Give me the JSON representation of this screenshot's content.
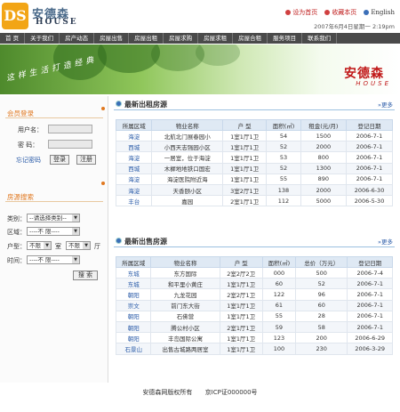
{
  "header": {
    "logo_ds": "DS",
    "logo_cn": "安德森",
    "logo_en": "HOUSE",
    "top_links": [
      {
        "label": "设为首页"
      },
      {
        "label": "收藏本页"
      },
      {
        "label": "English"
      }
    ],
    "date": "2007年6月4日星期一  2:19pm"
  },
  "nav": [
    "首  页",
    "关于我们",
    "房产动态",
    "房屋出售",
    "房屋出租",
    "房屋求购",
    "房屋求租",
    "房屋合租",
    "服务项目",
    "联系我们"
  ],
  "banner": {
    "slogan": "这样生活打造经典",
    "brand_cn": "安德森",
    "brand_en": "HOUSE"
  },
  "login": {
    "title": "会员登录",
    "user_label": "用户名：",
    "user_value": "",
    "pass_label": "密  码：",
    "pass_value": "",
    "forgot": "忘记密码",
    "login_btn": "登录",
    "register_btn": "注册"
  },
  "search": {
    "title": "房源搜索",
    "type_label": "类别：",
    "type_value": "--请选择类别--",
    "region_label": "区域：",
    "region_value": "----不  限----",
    "layout_label": "户型：",
    "room_value": "不限",
    "room_unit": "室",
    "hall_value": "不限",
    "hall_unit": "厅",
    "time_label": "时间：",
    "time_value": "----不  限----",
    "search_btn": "搜 索"
  },
  "rent": {
    "title": "最新出租房源",
    "more": "更多",
    "headers": [
      "所属区域",
      "物业名称",
      "户 型",
      "面积(㎡)",
      "租金(元/月)",
      "登记日期"
    ],
    "rows": [
      [
        "海淀",
        "北航北门展春园小",
        "1室1厅1卫",
        "54",
        "1500",
        "2006-7-1"
      ],
      [
        "西城",
        "小西天志强园小区",
        "1室1厅1卫",
        "52",
        "2000",
        "2006-7-1"
      ],
      [
        "海淀",
        "一居室，位于海淀",
        "1室1厅1卫",
        "53",
        "800",
        "2006-7-1"
      ],
      [
        "西城",
        "木樨地地铁口国宏",
        "1室1厅1卫",
        "52",
        "1300",
        "2006-7-1"
      ],
      [
        "海淀",
        "海淀医院附近海",
        "1室1厅1卫",
        "55",
        "890",
        "2006-7-1"
      ],
      [
        "海淀",
        "天香颐小区",
        "3室2厅1卫",
        "138",
        "2000",
        "2006-6-30"
      ],
      [
        "丰台",
        "嘉园",
        "2室1厅1卫",
        "112",
        "5000",
        "2006-5-30"
      ]
    ]
  },
  "sale": {
    "title": "最新出售房源",
    "more": "更多",
    "headers": [
      "所属区域",
      "物业名称",
      "户 型",
      "面积(㎡)",
      "总价（万元）",
      "登记日期"
    ],
    "rows": [
      [
        "东城",
        "东方国际",
        "2室2厅2卫",
        "000",
        "500",
        "2006-7-4"
      ],
      [
        "东城",
        "和平里小黄庄",
        "1室1厅1卫",
        "60",
        "52",
        "2006-7-1"
      ],
      [
        "朝阳",
        "九龙花园",
        "2室2厅1卫",
        "122",
        "96",
        "2006-7-1"
      ],
      [
        "崇文",
        "前门东大街",
        "1室1厅1卫",
        "61",
        "60",
        "2006-7-1"
      ],
      [
        "朝阳",
        "石佛营",
        "1室1厅1卫",
        "55",
        "28",
        "2006-7-1"
      ],
      [
        "朝阳",
        "腾公村小区",
        "2室1厅1卫",
        "59",
        "58",
        "2006-7-1"
      ],
      [
        "朝阳",
        "丰岛国际公寓",
        "1室1厅1卫",
        "123",
        "200",
        "2006-6-29"
      ],
      [
        "石景山",
        "出售古城路两居室",
        "1室1厅1卫",
        "100",
        "230",
        "2006-3-29"
      ]
    ]
  },
  "footer": {
    "copyright": "安德森网版权所有",
    "icp": "京ICP证000000号"
  }
}
